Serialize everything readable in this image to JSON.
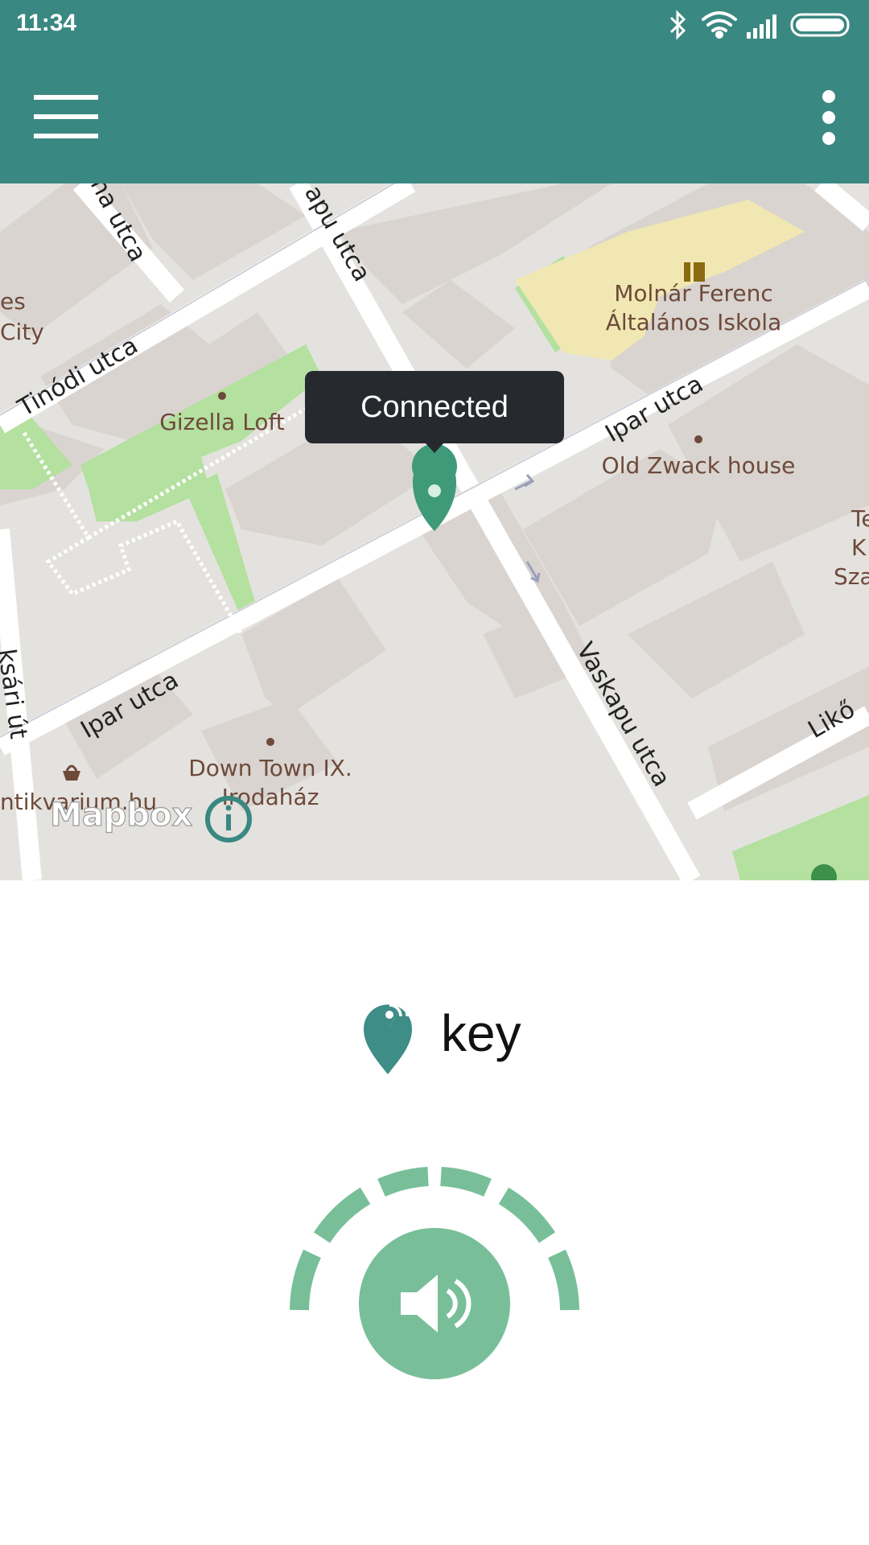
{
  "status_bar": {
    "time": "11:34"
  },
  "app_bar": {
    "menu_icon": "hamburger-menu-icon",
    "more_icon": "more-vert-icon"
  },
  "map": {
    "tooltip_text": "Connected",
    "streets": {
      "tinodi": "Tinódi utca",
      "ipar_upper": "Ipar utca",
      "ipar_lower": "Ipar utca",
      "vaskapu_upper": "apu utca",
      "vaskapu_lower": "Vaskapu utca",
      "na_utca": "na utca",
      "sari_ut": "ksári út",
      "likon": "Likő"
    },
    "pois": {
      "gizella": "Gizella Loft",
      "molnar_1": "Molnár Ferenc",
      "molnar_2": "Általános Iskola",
      "zwack": "Old Zwack house",
      "downtown_1": "Down Town IX.",
      "downtown_2": "Irodaház",
      "antikvarium": "ntikvarium.hu",
      "es": "es",
      "city": "City",
      "right_1": "Te",
      "right_2": "K",
      "right_3": "Sza"
    },
    "attribution": "Mapbox",
    "info_icon": "info-icon",
    "pin_icon": "map-pin-icon",
    "colors": {
      "pin": "#3f9a7a",
      "park": "#b4e0a0",
      "road": "#ffffff",
      "block": "#d9d4d0"
    }
  },
  "device": {
    "name": "key",
    "icon": "location-signal-icon"
  },
  "sound": {
    "icon": "speaker-icon",
    "accent": "#78bf99"
  }
}
